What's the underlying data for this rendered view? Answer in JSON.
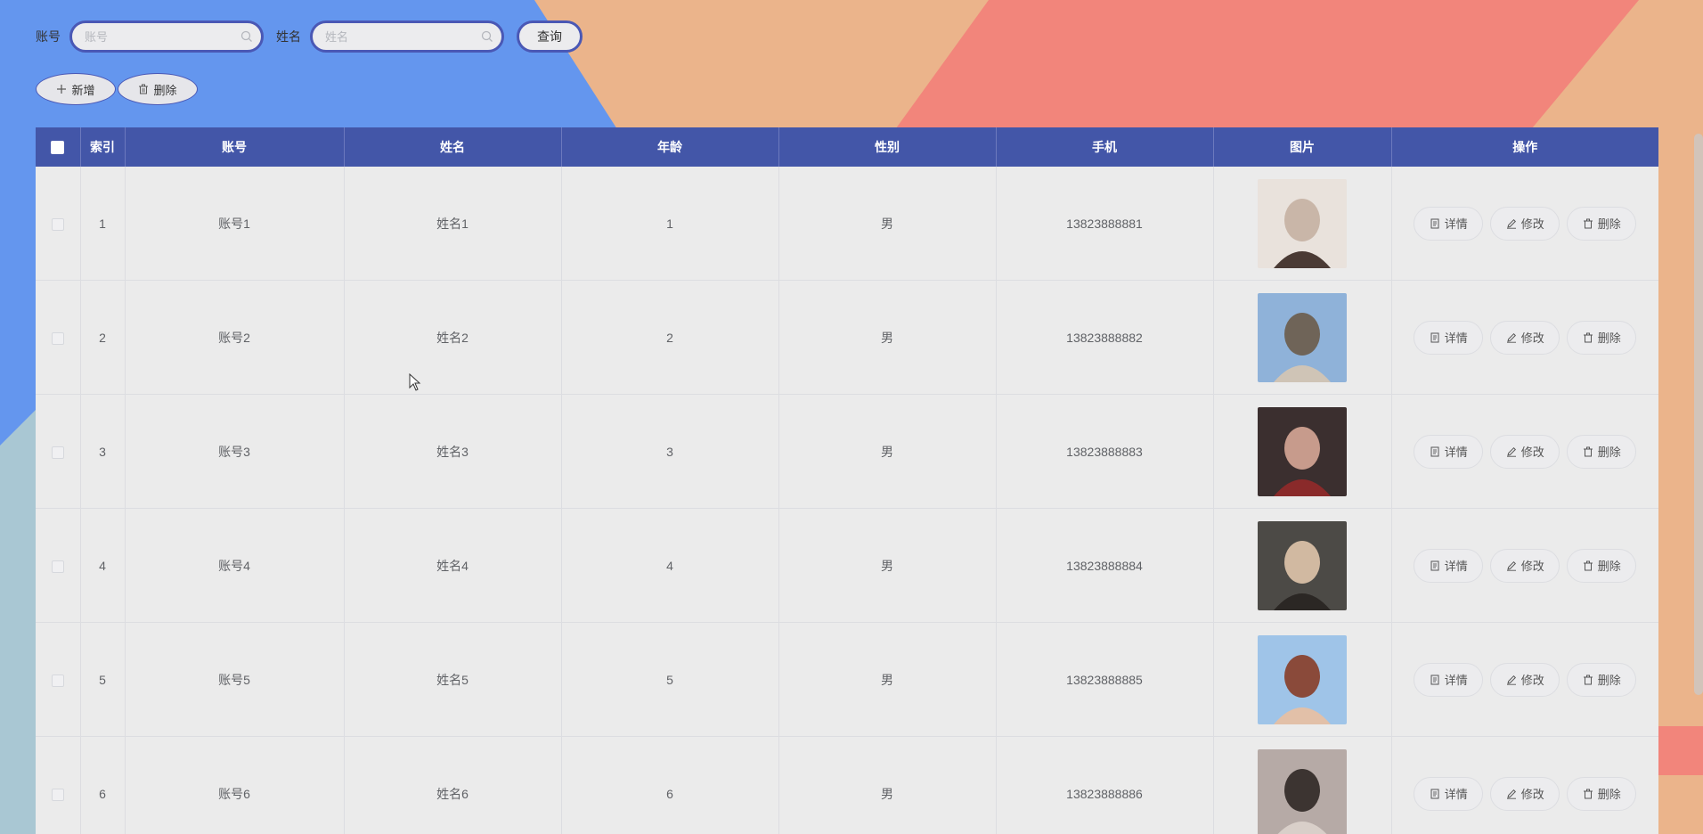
{
  "search": {
    "account_label": "账号",
    "account_placeholder": "账号",
    "name_label": "姓名",
    "name_placeholder": "姓名",
    "query_label": "查询"
  },
  "actions": {
    "add_label": "新增",
    "delete_label": "删除"
  },
  "table": {
    "headers": [
      "索引",
      "账号",
      "姓名",
      "年龄",
      "性别",
      "手机",
      "图片",
      "操作"
    ],
    "rows": [
      {
        "index": "1",
        "account": "账号1",
        "name": "姓名1",
        "age": "1",
        "gender": "男",
        "phone": "13823888881"
      },
      {
        "index": "2",
        "account": "账号2",
        "name": "姓名2",
        "age": "2",
        "gender": "男",
        "phone": "13823888882"
      },
      {
        "index": "3",
        "account": "账号3",
        "name": "姓名3",
        "age": "3",
        "gender": "男",
        "phone": "13823888883"
      },
      {
        "index": "4",
        "account": "账号4",
        "name": "姓名4",
        "age": "4",
        "gender": "男",
        "phone": "13823888884"
      },
      {
        "index": "5",
        "account": "账号5",
        "name": "姓名5",
        "age": "5",
        "gender": "男",
        "phone": "13823888885"
      },
      {
        "index": "6",
        "account": "账号6",
        "name": "姓名6",
        "age": "6",
        "gender": "男",
        "phone": "13823888886"
      }
    ],
    "row_actions": {
      "detail_label": "详情",
      "edit_label": "修改",
      "delete_label": "删除"
    }
  },
  "colors": {
    "header_bg": "#4356a8",
    "accent_border": "#4a58b5",
    "bg_blue": "#6496ee",
    "bg_orange": "#ebb48b",
    "bg_coral": "#f2857b",
    "bg_teal": "#a9c7d3"
  },
  "icons": {
    "search": "search-icon",
    "add": "plus-icon",
    "delete": "trash-icon",
    "detail": "document-icon",
    "edit": "pencil-icon"
  }
}
